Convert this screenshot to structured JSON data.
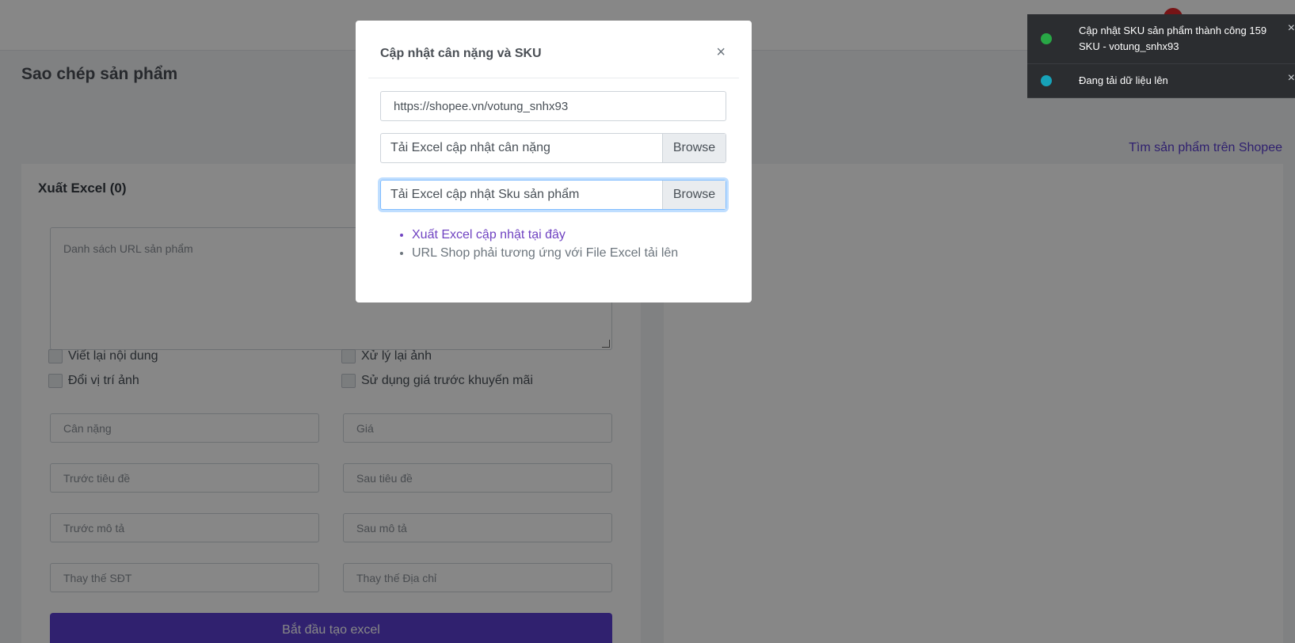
{
  "page": {
    "title": "Sao chép sản phẩm",
    "find_link": "Tìm sản phẩm trên Shopee"
  },
  "export_card": {
    "title": "Xuất Excel (0)",
    "url_list_placeholder": "Danh sách URL sản phẩm",
    "checkboxes": [
      "Viết lại nội dung",
      "Xử lý lại ảnh",
      "Đổi vị trí ảnh",
      "Sử dụng giá trước khuyến mãi"
    ],
    "fields": [
      "Cân nặng",
      "Giá",
      "Trước tiêu đề",
      "Sau tiêu đề",
      "Trước mô tả",
      "Sau mô tả",
      "Thay thế SĐT",
      "Thay thế Địa chỉ"
    ],
    "start_button": "Bắt đầu tạo excel"
  },
  "modal": {
    "title": "Cập nhật cân nặng và SKU",
    "close": "×",
    "shop_url": "https://shopee.vn/votung_snhx93",
    "weight_file_label": "Tải Excel cập nhật cân nặng",
    "sku_file_label": "Tải Excel cập nhật Sku sản phẩm",
    "browse_label": "Browse",
    "export_link": "Xuất Excel cập nhật tại đây",
    "note": "URL Shop phải tương ứng với File Excel tải lên"
  },
  "toasts": [
    {
      "text": "Cập nhật SKU sản phẩm thành công 159 SKU - votung_snhx93",
      "status": "success",
      "color": "#28a745"
    },
    {
      "text": "Đang tải dữ liệu lên",
      "status": "info",
      "color": "#17a2b8"
    }
  ],
  "toast_close": "×",
  "colors": {
    "accent": "#5b3fd1",
    "link": "#6f42c1",
    "overlay": "rgba(0,0,0,0.47)"
  }
}
